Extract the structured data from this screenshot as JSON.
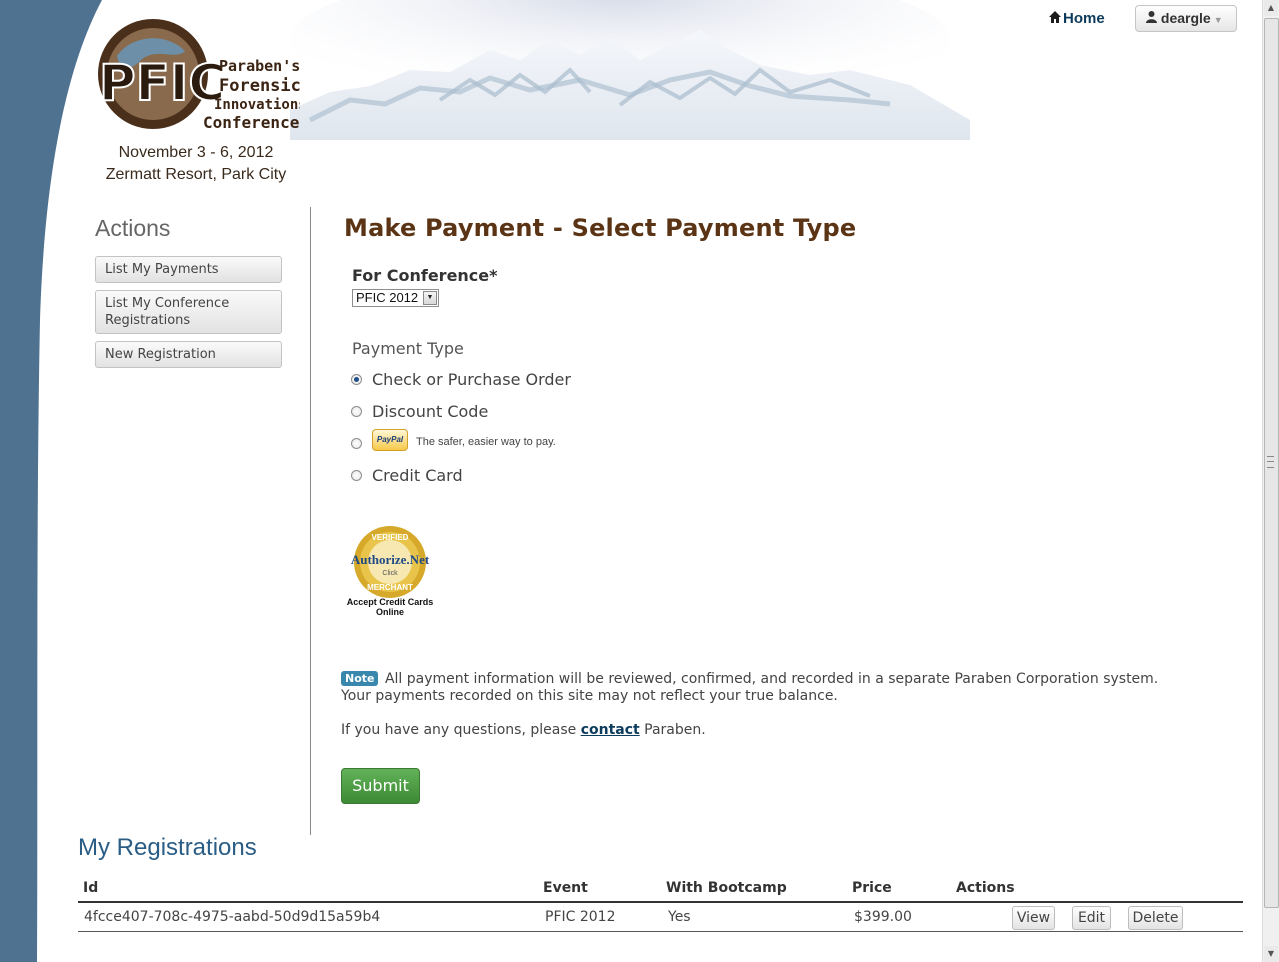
{
  "brand": {
    "logo_letters": "PFIC",
    "logo_line1": "Paraben's",
    "logo_line2": "Forensic",
    "logo_line3": "Innovations",
    "logo_line4": "Conference",
    "dates": "November 3 - 6, 2012",
    "venue": "Zermatt Resort, Park City"
  },
  "nav": {
    "home_label": "Home",
    "user_label": "deargle"
  },
  "sidebar": {
    "title": "Actions",
    "items": [
      {
        "label": "List My Payments"
      },
      {
        "label": "List My Conference Registrations"
      },
      {
        "label": "New Registration"
      }
    ]
  },
  "form": {
    "title": "Make Payment - Select Payment Type",
    "conference_label": "For Conference*",
    "conference_value": "PFIC 2012",
    "payment_type_label": "Payment Type",
    "options": [
      {
        "label": "Check or Purchase Order",
        "checked": true
      },
      {
        "label": "Discount Code",
        "checked": false
      },
      {
        "label": "PayPal",
        "tagline": "The safer, easier way to pay.",
        "checked": false
      },
      {
        "label": "Credit Card",
        "checked": false
      }
    ],
    "seal": {
      "top_text": "VERIFIED",
      "brand_text": "Authorize.Net",
      "click_text": "Click",
      "bottom_text": "MERCHANT",
      "caption_line1": "Accept Credit Cards",
      "caption_line2": "Online"
    },
    "note_badge": "Note",
    "note_text": "All payment information will be reviewed, confirmed, and recorded in a separate Paraben Corporation system. Your payments recorded on this site may not reflect your true balance.",
    "questions_prefix": "If you have any questions, please",
    "contact_link": "contact",
    "questions_suffix": "Paraben.",
    "submit_label": "Submit"
  },
  "registrations": {
    "title": "My Registrations",
    "columns": [
      "Id",
      "Event",
      "With Bootcamp",
      "Price",
      "Actions"
    ],
    "rows": [
      {
        "id": "4fcce407-708c-4975-aabd-50d9d15a59b4",
        "event": "PFIC 2012",
        "bootcamp": "Yes",
        "price": "$399.00",
        "actions": [
          "View",
          "Edit",
          "Delete"
        ]
      }
    ]
  },
  "colors": {
    "left_band": "#4f7291",
    "title_brown": "#5a3414",
    "link_blue": "#0d3b5c",
    "submit_green": "#4f9e46",
    "note_badge": "#3a87ad"
  }
}
